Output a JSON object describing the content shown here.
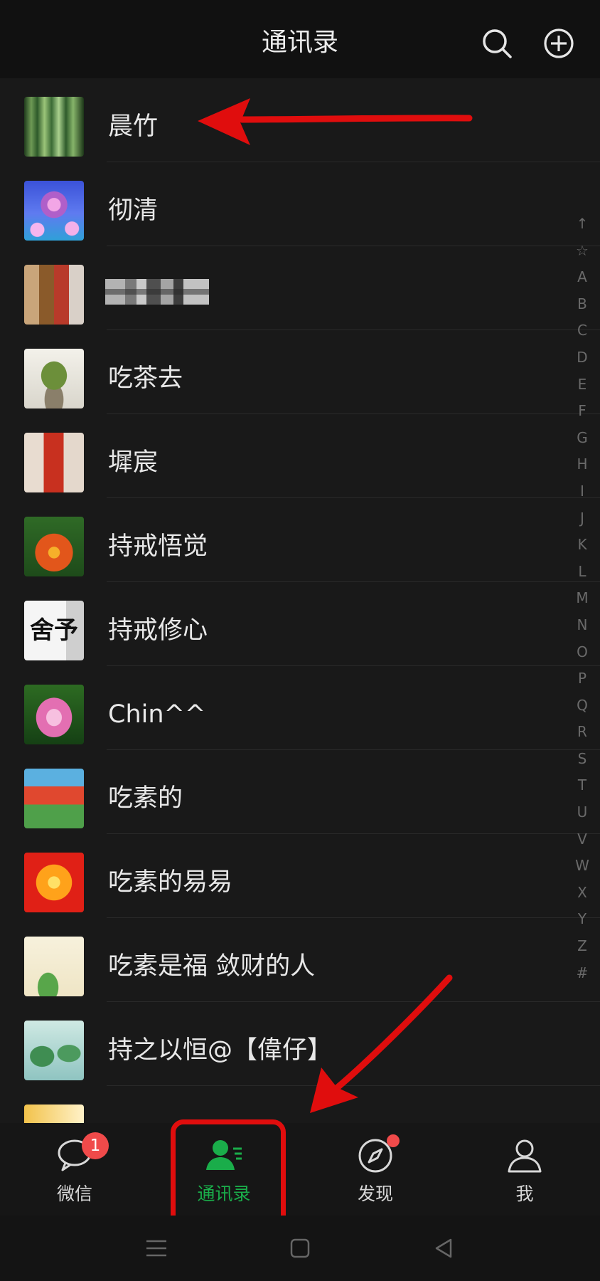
{
  "header": {
    "title": "通讯录",
    "icons": [
      "search-icon",
      "add-icon"
    ]
  },
  "contacts": [
    {
      "name": "晨竹",
      "avatar": "bamboo-forest"
    },
    {
      "name": "彻清",
      "avatar": "lotus-blue"
    },
    {
      "name": "",
      "avatar": "pixelated-photo",
      "redacted": true
    },
    {
      "name": "吃茶去",
      "avatar": "bonsai-tree"
    },
    {
      "name": "墀宸",
      "avatar": "pixelated-person"
    },
    {
      "name": "持戒悟觉",
      "avatar": "orange-lily-text"
    },
    {
      "name": "持戒修心",
      "avatar": "calligraphy-text",
      "avatar_text": "舍予"
    },
    {
      "name": "Chin^^",
      "avatar": "pink-lotus"
    },
    {
      "name": "吃素的",
      "avatar": "poster-text"
    },
    {
      "name": "吃素的易易",
      "avatar": "orange-flower"
    },
    {
      "name": "吃素是福 敛财的人",
      "avatar": "scroll-lotus"
    },
    {
      "name": "持之以恒@【偉仔】",
      "avatar": "lotus-pond"
    }
  ],
  "index_bar": [
    "↑",
    "☆",
    "A",
    "B",
    "C",
    "D",
    "E",
    "F",
    "G",
    "H",
    "I",
    "J",
    "K",
    "L",
    "M",
    "N",
    "O",
    "P",
    "Q",
    "R",
    "S",
    "T",
    "U",
    "V",
    "W",
    "X",
    "Y",
    "Z",
    "#"
  ],
  "tabs": [
    {
      "label": "微信",
      "icon": "chat-icon",
      "badge": "1"
    },
    {
      "label": "通讯录",
      "icon": "contacts-icon",
      "active": true
    },
    {
      "label": "发现",
      "icon": "compass-icon",
      "dot": true
    },
    {
      "label": "我",
      "icon": "person-icon"
    }
  ],
  "colors": {
    "background": "#191919",
    "accent": "#1aad4a",
    "badge": "#f04a4a",
    "annotation": "#e00d0d"
  }
}
